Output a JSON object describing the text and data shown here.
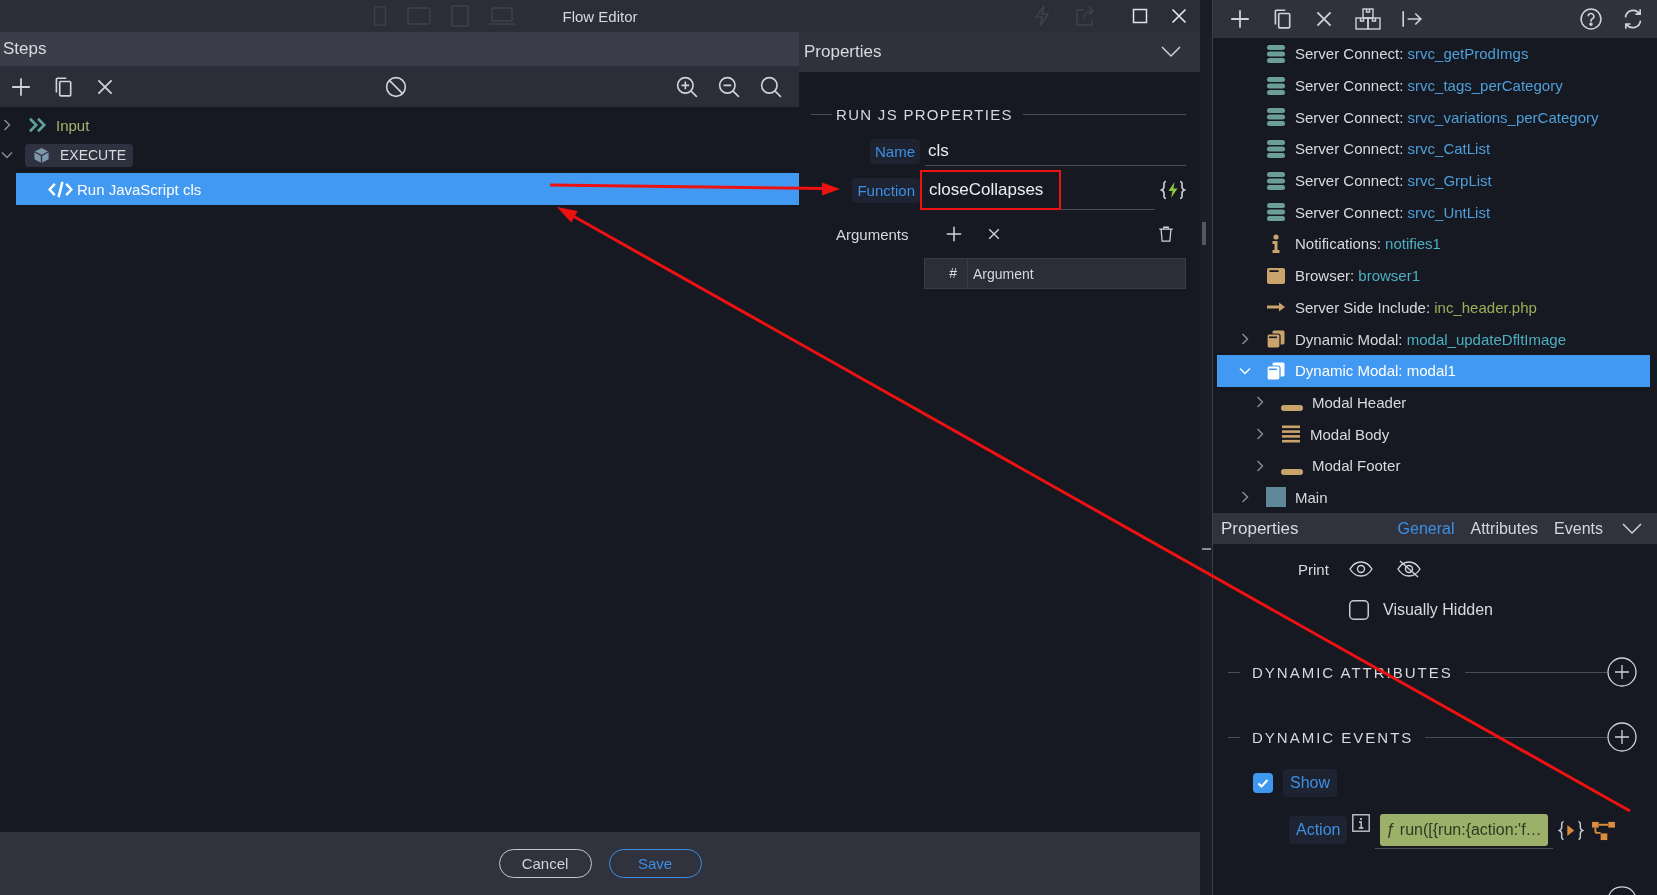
{
  "window": {
    "title": "Flow Editor"
  },
  "steps": {
    "title": "Steps",
    "tree": [
      {
        "kind": "input",
        "label": "Input",
        "expanded": false,
        "selected": false
      },
      {
        "kind": "group",
        "label": "EXECUTE",
        "expanded": true,
        "selected": false,
        "children": [
          {
            "kind": "action",
            "label": "Run JavaScript cls",
            "selected": true
          }
        ]
      }
    ]
  },
  "properties": {
    "title": "Properties",
    "section": "RUN JS PROPERTIES",
    "fields": [
      {
        "kind": "text",
        "label": "Name",
        "value": "cls",
        "highlighted": false
      },
      {
        "kind": "function",
        "label": "Function",
        "value": "closeCollapses",
        "highlighted": true
      }
    ],
    "arguments": {
      "label": "Arguments",
      "columns": [
        "#",
        "Argument"
      ]
    }
  },
  "footer": {
    "buttons": [
      {
        "kind": "secondary",
        "label": "Cancel"
      },
      {
        "kind": "primary",
        "label": "Save"
      }
    ]
  },
  "structure": {
    "tree": [
      {
        "kind": "server_connect",
        "type": "Server Connect:",
        "name": "srvc_getProdImgs",
        "selected": false
      },
      {
        "kind": "server_connect",
        "type": "Server Connect:",
        "name": "srvc_tags_perCategory",
        "selected": false
      },
      {
        "kind": "server_connect",
        "type": "Server Connect:",
        "name": "srvc_variations_perCategory",
        "selected": false
      },
      {
        "kind": "server_connect",
        "type": "Server Connect:",
        "name": "srvc_CatList",
        "selected": false
      },
      {
        "kind": "server_connect",
        "type": "Server Connect:",
        "name": "srvc_GrpList",
        "selected": false
      },
      {
        "kind": "server_connect",
        "type": "Server Connect:",
        "name": "srvc_UntList",
        "selected": false
      },
      {
        "kind": "notifications",
        "type": "Notifications:",
        "name": "notifies1",
        "selected": false
      },
      {
        "kind": "browser",
        "type": "Browser:",
        "name": "browser1",
        "selected": false
      },
      {
        "kind": "include",
        "type": "Server Side Include:",
        "name": "inc_header.php",
        "selected": false
      },
      {
        "kind": "modal",
        "type": "Dynamic Modal:",
        "name": "modal_updateDfltImage",
        "expanded": false,
        "selected": false
      },
      {
        "kind": "modal",
        "type": "Dynamic Modal:",
        "name": "modal1",
        "expanded": true,
        "selected": true,
        "children": [
          {
            "kind": "modal_header",
            "type": "Modal Header",
            "expanded": false,
            "selected": false
          },
          {
            "kind": "modal_body",
            "type": "Modal Body",
            "expanded": false,
            "selected": false
          },
          {
            "kind": "modal_footer",
            "type": "Modal Footer",
            "expanded": false,
            "selected": false
          }
        ]
      },
      {
        "kind": "container",
        "type": "Main",
        "expanded": false,
        "selected": false
      }
    ]
  },
  "element_properties": {
    "title": "Properties",
    "tabs": [
      {
        "label": "General",
        "selected": true
      },
      {
        "label": "Attributes",
        "selected": false
      },
      {
        "label": "Events",
        "selected": false
      }
    ],
    "print": {
      "label": "Print"
    },
    "visually_hidden": {
      "label": "Visually Hidden",
      "checked": false
    },
    "sections": [
      {
        "title": "DYNAMIC ATTRIBUTES"
      },
      {
        "title": "DYNAMIC EVENTS",
        "events": [
          {
            "label": "Show",
            "checked": true,
            "action": {
              "label": "Action",
              "value": "ƒ run([{run:{action:'f…"
            }
          }
        ]
      }
    ]
  }
}
